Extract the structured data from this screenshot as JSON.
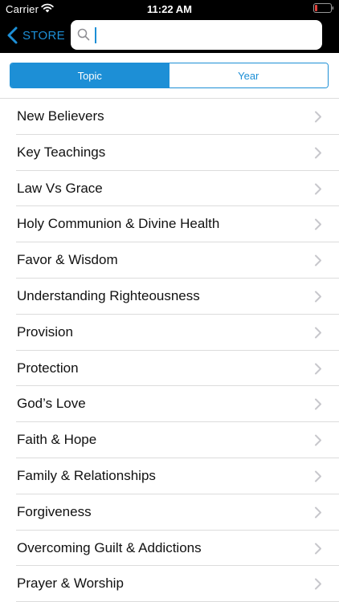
{
  "status_bar": {
    "carrier": "Carrier",
    "time": "11:22 AM",
    "wifi_icon": "wifi-icon",
    "battery_icon": "battery-low-icon",
    "battery_color": "#e0403a"
  },
  "navbar": {
    "back_label": "STORE",
    "back_icon": "chevron-left-icon",
    "search": {
      "value": "",
      "placeholder": "",
      "icon": "search-icon"
    }
  },
  "segments": {
    "selected": "Topic",
    "items": [
      {
        "label": "Topic"
      },
      {
        "label": "Year"
      }
    ]
  },
  "topics": [
    {
      "label": "New Believers"
    },
    {
      "label": "Key Teachings"
    },
    {
      "label": "Law Vs Grace"
    },
    {
      "label": "Holy Communion & Divine Health"
    },
    {
      "label": "Favor & Wisdom"
    },
    {
      "label": "Understanding Righteousness"
    },
    {
      "label": "Provision"
    },
    {
      "label": "Protection"
    },
    {
      "label": "God’s Love"
    },
    {
      "label": "Faith & Hope"
    },
    {
      "label": "Family & Relationships"
    },
    {
      "label": "Forgiveness"
    },
    {
      "label": "Overcoming Guilt & Addictions"
    },
    {
      "label": "Prayer & Worship"
    }
  ],
  "colors": {
    "accent": "#1d8fd6",
    "navbar_bg": "#000000",
    "separator": "#dcdcdc",
    "chevron": "#c7c7cc"
  }
}
